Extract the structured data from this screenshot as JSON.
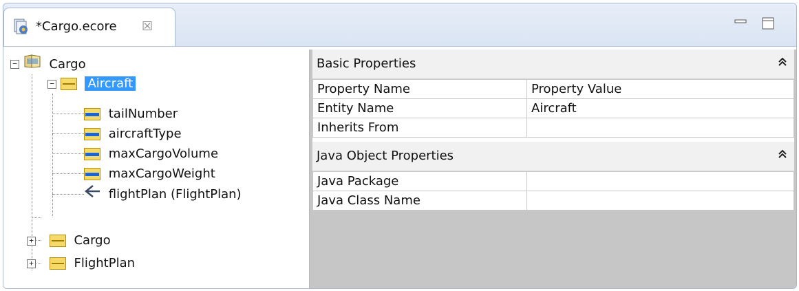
{
  "editor": {
    "tab_title": "*Cargo.ecore",
    "close_glyph": "☒",
    "minimize_glyph": "–",
    "maximize_glyph": "☐"
  },
  "tree": {
    "root": {
      "label": "Cargo",
      "expander": "−"
    },
    "aircraft": {
      "label": "Aircraft",
      "expander": "−"
    },
    "attributes": [
      "tailNumber",
      "aircraftType",
      "maxCargoVolume",
      "maxCargoWeight"
    ],
    "reference": "flightPlan (FlightPlan)",
    "cargo": {
      "label": "Cargo",
      "expander": "+"
    },
    "flightplan": {
      "label": "FlightPlan",
      "expander": "+"
    }
  },
  "properties": {
    "basic": {
      "title": "Basic Properties",
      "collapse": "⌃",
      "header": [
        "Property Name",
        "Property Value"
      ],
      "rows": [
        [
          "Entity Name",
          "Aircraft"
        ],
        [
          "Inherits From",
          ""
        ]
      ]
    },
    "java": {
      "title": "Java Object Properties",
      "collapse": "⌃",
      "rows": [
        [
          "Java Package",
          ""
        ],
        [
          "Java Class Name",
          ""
        ]
      ]
    }
  }
}
